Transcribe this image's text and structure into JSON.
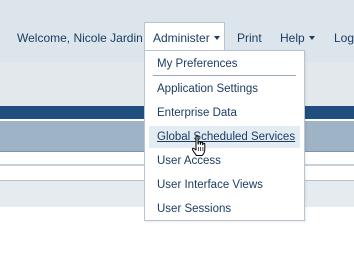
{
  "header": {
    "welcome": "Welcome, Nicole Jardin",
    "nav": {
      "administer": "Administer",
      "print": "Print",
      "help": "Help",
      "logout": "Logo"
    }
  },
  "admin_menu": {
    "items": [
      "My Preferences",
      "Application Settings",
      "Enterprise Data",
      "Global Scheduled Services",
      "User Access",
      "User Interface Views",
      "User Sessions"
    ],
    "hovered": "Global Scheduled Services"
  },
  "icons": {
    "caret": "chevron-down-icon",
    "cursor": "hand-pointer-icon"
  },
  "colors": {
    "text": "#1b3d63",
    "header_bg": "#dde5ec",
    "band_dark": "#1f4e7f",
    "band_mid": "#9fb3c6",
    "hover_bg": "#e3ebf3"
  }
}
